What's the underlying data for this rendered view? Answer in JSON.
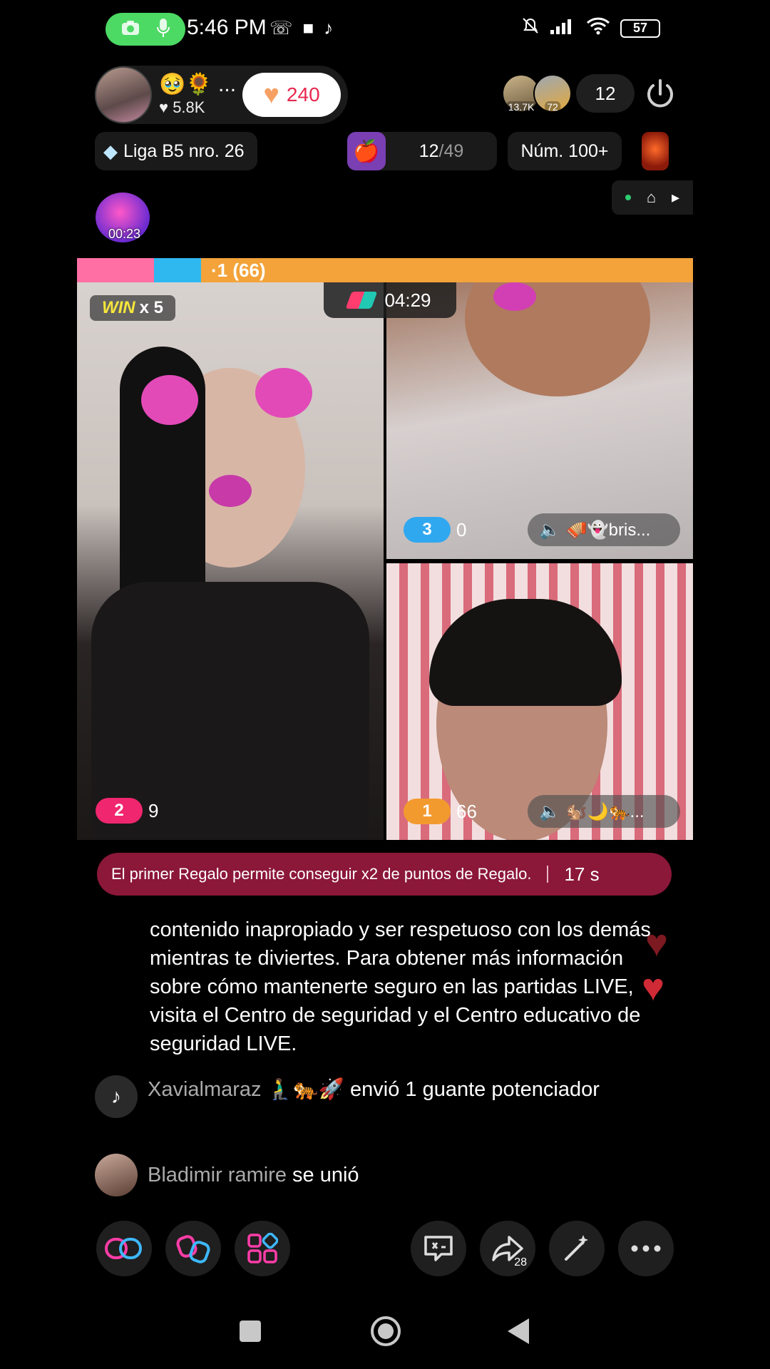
{
  "status_bar": {
    "time": "5:46 PM",
    "battery": "57"
  },
  "host": {
    "emoji": "🥹🌻 ...",
    "likes": "5.8K",
    "follow_count": "240"
  },
  "viewers": {
    "badge_1": "13.7K",
    "badge_2": "72",
    "count": "12"
  },
  "badges": {
    "league": "Liga B5 nro. 26",
    "rank_current": "12",
    "rank_total": "/49",
    "number": "Núm. 100+"
  },
  "lightning_timer": "00:23",
  "score_bar": {
    "text": "·1 (66)"
  },
  "battle": {
    "win_label": "WIN",
    "win_multiplier": "x 5",
    "timer": "04:29",
    "tiles": [
      {
        "rank": "2",
        "score": "9",
        "color": "#f0266e"
      },
      {
        "rank": "3",
        "score": "0",
        "color": "#2fa8f0",
        "name": "🪗👻bris..."
      },
      {
        "rank": "1",
        "score": "66",
        "color": "#f39a2f",
        "name": "🐿️🌙🐅..."
      }
    ]
  },
  "promo": {
    "text": "El primer Regalo permite conseguir x2 de puntos de Regalo.",
    "seconds": "17 s"
  },
  "chat": {
    "notice": "contenido inapropiado y ser respetuoso con los demás mientras te diviertes. Para obtener más información sobre cómo mantenerte seguro en las partidas LIVE, visita el Centro de seguridad y el Centro educativo de seguridad LIVE.",
    "messages": [
      {
        "user": "Xavialmaraz 🧎‍♂️🐅🚀",
        "text": " envió 1 guante potenciador"
      },
      {
        "user": "Bladimir ramire",
        "text": " se unió"
      }
    ]
  },
  "actions": {
    "share_count": "28"
  },
  "colors": {
    "accent_pink": "#f0266e",
    "accent_orange": "#f3a33a",
    "banner": "#8b1739"
  }
}
